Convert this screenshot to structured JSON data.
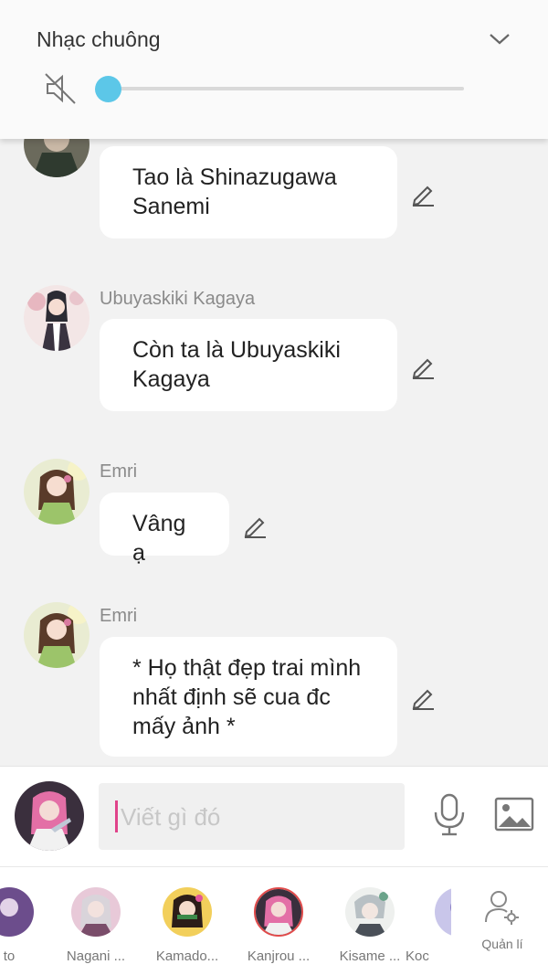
{
  "volume": {
    "title": "Nhạc chuông",
    "level": 0
  },
  "messages": [
    {
      "sender": "",
      "text": "Tao là Shinazugawa Sanemi",
      "avatar": "sanemi-avatar"
    },
    {
      "sender": "Ubuyaskiki Kagaya",
      "text": "Còn ta là Ubuyaskiki Kagaya",
      "avatar": "kagaya-avatar"
    },
    {
      "sender": "Emri",
      "text": "Vâng ạ",
      "avatar": "emri-avatar"
    },
    {
      "sender": "Emri",
      "text": "* Họ thật đẹp trai mình nhất định sẽ cua đc mấy ảnh *",
      "avatar": "emri-avatar"
    }
  ],
  "composer": {
    "placeholder": "Viết gì đó"
  },
  "tray": {
    "characters": [
      {
        "name": "to"
      },
      {
        "name": "Nagani ..."
      },
      {
        "name": "Kamado..."
      },
      {
        "name": "Kanjrou ..."
      },
      {
        "name": "Kisame ..."
      },
      {
        "name": "Koc"
      }
    ],
    "manage_label": "Quản lí"
  },
  "colors": {
    "accent": "#5cc7e8",
    "caret": "#e0438a",
    "selected_ring": "#e04a4a"
  }
}
